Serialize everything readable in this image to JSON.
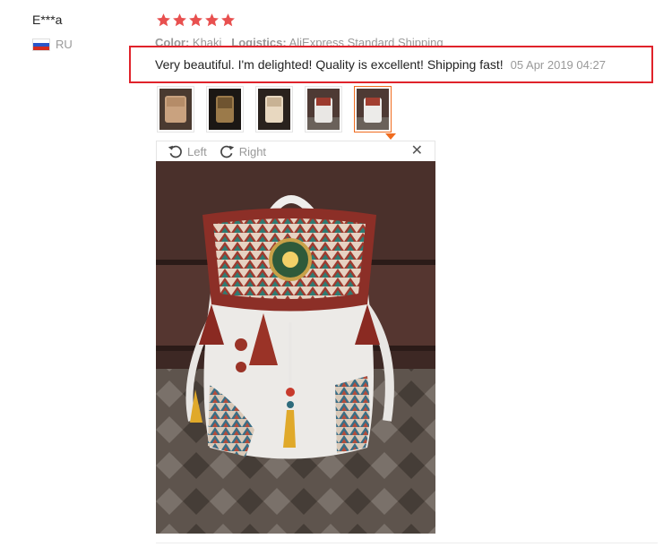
{
  "review": {
    "user_name": "E***a",
    "country_code": "RU",
    "rating": 5,
    "color_label": "Color:",
    "color_value": "Khaki",
    "logistics_label": "Logistics:",
    "logistics_value": "AliExpress Standard Shipping",
    "text": "Very beautiful. I'm delighted! Quality is excellent! Shipping fast!",
    "date": "05 Apr 2019 04:27"
  },
  "viewer": {
    "rotate_left_label": "Left",
    "rotate_right_label": "Right",
    "close_icon": "close-icon",
    "selected_index": 4
  },
  "thumbnails": [
    {
      "name": "photo-1"
    },
    {
      "name": "photo-2"
    },
    {
      "name": "photo-3"
    },
    {
      "name": "photo-4"
    },
    {
      "name": "photo-5"
    }
  ],
  "colors": {
    "star": "#e8504f",
    "highlight_border": "#e0232b",
    "active_thumb": "#f06c1f",
    "muted_text": "#999999"
  }
}
